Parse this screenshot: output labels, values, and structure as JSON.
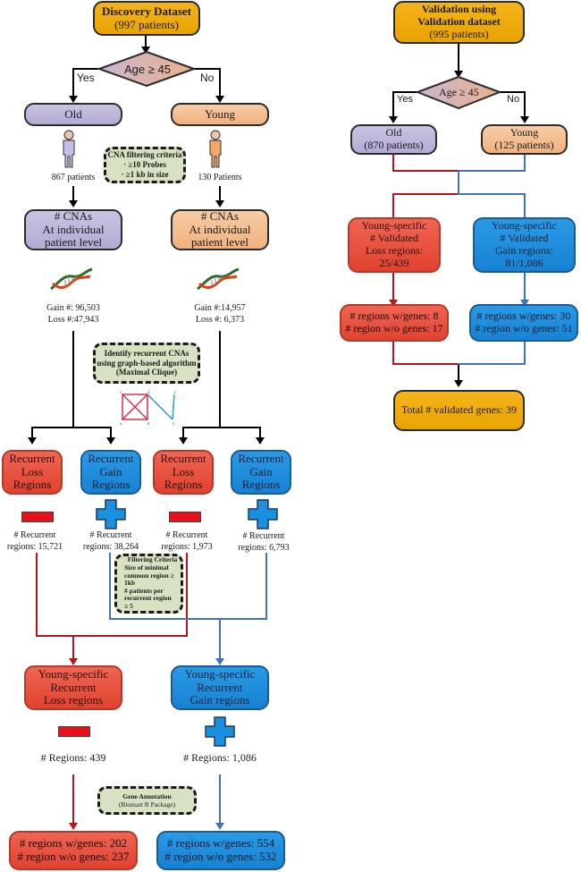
{
  "discovery": {
    "start_title": "Discovery Dataset",
    "start_count": "(997 patients)",
    "decision": "Age ≥ 45",
    "yes_label": "Yes",
    "no_label": "No",
    "old_label": "Old",
    "young_label": "Young",
    "old_patients": "867 patients",
    "young_patients": "130 Patients",
    "filter_note": {
      "title": "CNA filtering criteria",
      "items": [
        "·      ≥10 Probes",
        "·    ≥1 kb in size"
      ]
    },
    "cna_box": [
      "# CNAs",
      "At individual",
      "patient level"
    ],
    "old_counts": [
      "Gain #: 96,503",
      "Loss #:47,943"
    ],
    "young_counts": [
      "Gain #:14,957",
      "Loss #: 6,373"
    ],
    "algorithm_note": [
      "Identify recurrent CNAs",
      "using graph-based algorithm",
      "(Maximal Clique)"
    ],
    "clique_nodes": [
      "C",
      "D",
      "A",
      "B",
      "F",
      "E"
    ],
    "recurrent_loss": [
      "Recurrent",
      "Loss",
      "Regions"
    ],
    "recurrent_gain": [
      "Recurrent",
      "Gain",
      "Regions"
    ],
    "old_loss_count": [
      "# Recurrent",
      "regions: 15,721"
    ],
    "old_gain_count": [
      "# Recurrent",
      "regions: 38,264"
    ],
    "young_loss_count": [
      "# Recurrent",
      "regions: 1,973"
    ],
    "young_gain_count": [
      "# Recurrent",
      "regions: 6,793"
    ],
    "filtering_note": [
      "Filtering Criteria",
      "Size of minimal",
      "common region ≥",
      "1kb",
      "# patients per",
      "recurrent region",
      "≥ 5"
    ],
    "ys_loss": [
      "Young-specific",
      "Recurrent",
      "Loss regions"
    ],
    "ys_gain": [
      "Young-specific",
      "Recurrent",
      "Gain regions"
    ],
    "ys_loss_regions": "# Regions: 439",
    "ys_gain_regions": "# Regions: 1,086",
    "annotation_note": [
      "Gene Annotation",
      "(Biomart R Package)"
    ],
    "loss_genes": [
      "# regions w/genes: 202",
      "# region w/o genes: 237"
    ],
    "gain_genes": [
      "# regions w/genes: 554",
      "# region w/o genes: 532"
    ]
  },
  "validation": {
    "start_title": [
      "Validation using",
      "Validation dataset"
    ],
    "start_count": "(995 patients)",
    "decision": "Age ≥ 45",
    "yes_label": "Yes",
    "no_label": "No",
    "old": [
      "Old",
      "(870 patients)"
    ],
    "young": [
      "Young",
      "(125 patients)"
    ],
    "loss_validated": [
      "Young-specific",
      "# Validated",
      "Loss regions:",
      "25/439"
    ],
    "gain_validated": [
      "Young-specific",
      "# Validated",
      "Gain regions:",
      "81/1,086"
    ],
    "loss_genes": [
      "# regions w/genes: 8",
      "# region w/o genes: 17"
    ],
    "gain_genes": [
      "# regions w/genes: 30",
      "# region w/o genes: 51"
    ],
    "total": "Total # validated genes: 39"
  },
  "colors": {
    "gold": "#f0ab0f",
    "old_purple": "#bfb6dc",
    "young_peach": "#f4bd90",
    "loss_red": "#e6513d",
    "gain_blue": "#1f8fdd",
    "note_green": "#d8e2c2",
    "red_line": "#b8141e",
    "blue_line": "#4472b8"
  }
}
